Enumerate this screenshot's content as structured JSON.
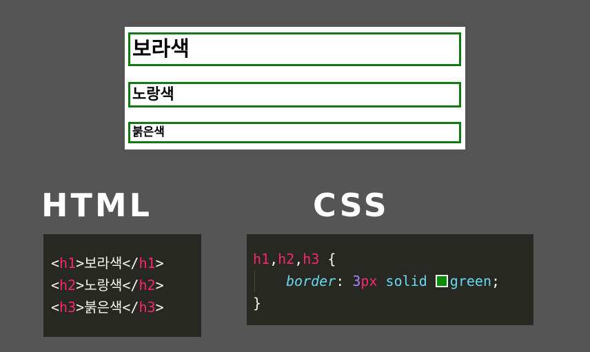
{
  "preview": {
    "h1_text": "보라색",
    "h2_text": "노랑색",
    "h3_text": "붉은색",
    "border_color": "#0f7a12"
  },
  "labels": {
    "html": "HTML",
    "css": "CSS"
  },
  "html_code": {
    "lines": [
      {
        "open_lt": "<",
        "tag_open": "h1",
        "open_gt": ">",
        "content": "보라색",
        "close_lt": "</",
        "tag_close": "h1",
        "close_gt": ">"
      },
      {
        "open_lt": "<",
        "tag_open": "h2",
        "open_gt": ">",
        "content": "노랑색",
        "close_lt": "</",
        "tag_close": "h2",
        "close_gt": ">"
      },
      {
        "open_lt": "<",
        "tag_open": "h3",
        "open_gt": ">",
        "content": "붉은색",
        "close_lt": "</",
        "tag_close": "h3",
        "close_gt": ">"
      }
    ]
  },
  "css_code": {
    "selector_1": "h1",
    "comma_1": ",",
    "selector_2": "h2",
    "comma_2": ",",
    "selector_3": "h3",
    "open_brace": " {",
    "property": "border",
    "colon": ": ",
    "number": "3",
    "unit": "px",
    "keyword": " solid ",
    "color_value": "green",
    "semicolon": ";",
    "close_brace": "}",
    "swatch_color": "#0a8a0a"
  },
  "colors": {
    "background": "#555555",
    "code_background": "#272822",
    "tag": "#f92672",
    "keyword": "#66d9ef",
    "number": "#ae81ff"
  }
}
